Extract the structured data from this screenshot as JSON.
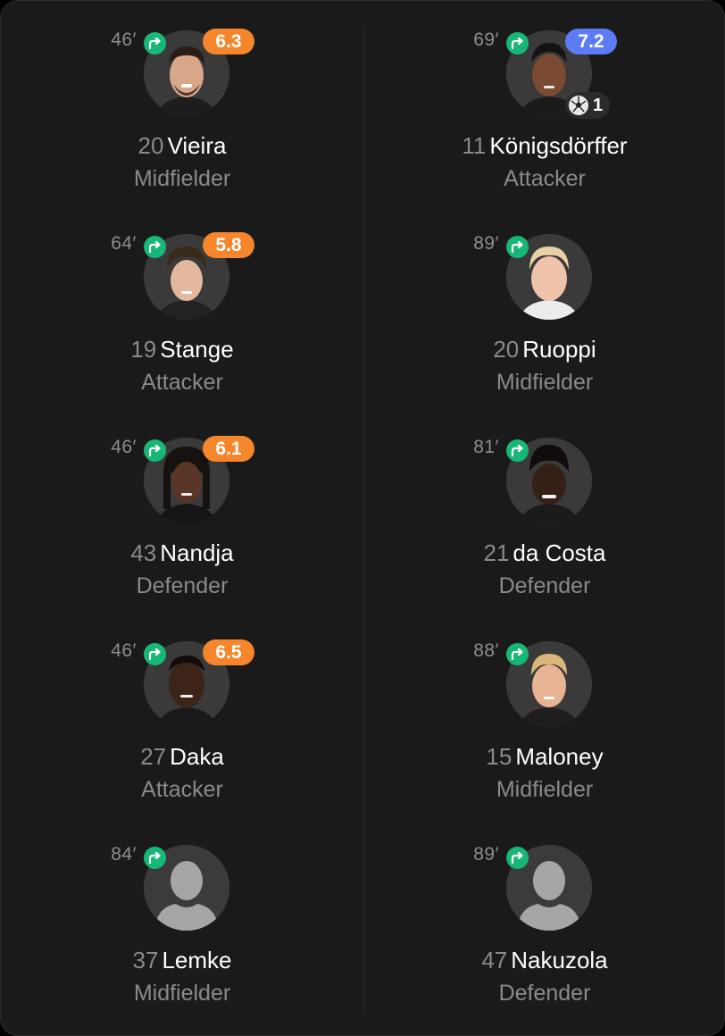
{
  "colors": {
    "card_bg": "#1a1a1a",
    "sub_icon": "#17b877",
    "rating_orange": "#f5862b",
    "rating_blue": "#5b7cf5",
    "muted_text": "#8a8a8a"
  },
  "left": [
    {
      "minute": "46′",
      "rating": "6.3",
      "rating_color": "#f5862b",
      "number": "20",
      "name": "Vieira",
      "position": "Midfielder",
      "photo": "player-photo"
    },
    {
      "minute": "64′",
      "rating": "5.8",
      "rating_color": "#f5862b",
      "number": "19",
      "name": "Stange",
      "position": "Attacker",
      "photo": "player-photo"
    },
    {
      "minute": "46′",
      "rating": "6.1",
      "rating_color": "#f5862b",
      "number": "43",
      "name": "Nandja",
      "position": "Defender",
      "photo": "player-photo"
    },
    {
      "minute": "46′",
      "rating": "6.5",
      "rating_color": "#f5862b",
      "number": "27",
      "name": "Daka",
      "position": "Attacker",
      "photo": "player-photo"
    },
    {
      "minute": "84′",
      "rating": null,
      "number": "37",
      "name": "Lemke",
      "position": "Midfielder",
      "photo": "placeholder-silhouette"
    }
  ],
  "right": [
    {
      "minute": "69′",
      "rating": "7.2",
      "rating_color": "#5b7cf5",
      "goals": "1",
      "number": "11",
      "name": "Königsdörffer",
      "position": "Attacker",
      "photo": "player-photo"
    },
    {
      "minute": "89′",
      "rating": null,
      "number": "20",
      "name": "Ruoppi",
      "position": "Midfielder",
      "photo": "player-photo"
    },
    {
      "minute": "81′",
      "rating": null,
      "number": "21",
      "name": "da Costa",
      "position": "Defender",
      "photo": "player-photo"
    },
    {
      "minute": "88′",
      "rating": null,
      "number": "15",
      "name": "Maloney",
      "position": "Midfielder",
      "photo": "player-photo"
    },
    {
      "minute": "89′",
      "rating": null,
      "number": "47",
      "name": "Nakuzola",
      "position": "Defender",
      "photo": "placeholder-silhouette"
    }
  ],
  "icons": {
    "substitution": "sub-in-arrow-icon",
    "goal": "football-icon"
  }
}
